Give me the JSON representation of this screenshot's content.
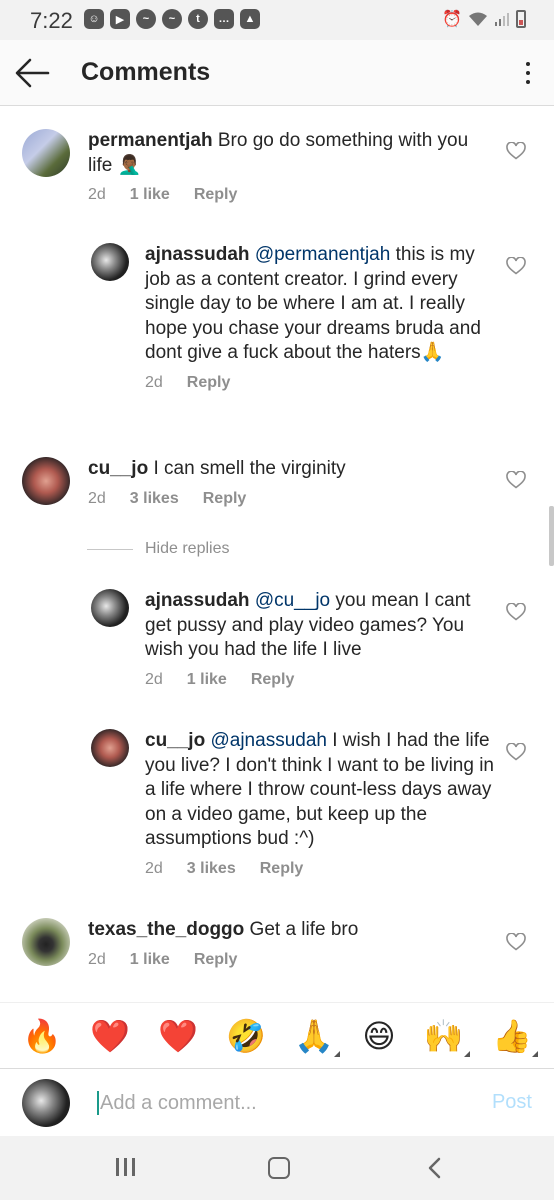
{
  "status_bar": {
    "time": "7:22",
    "left_icons": [
      "discord-icon",
      "youtube-icon",
      "messenger-icon",
      "messenger-icon",
      "tumblr-icon",
      "chat-icon",
      "gallery-icon"
    ],
    "right_icons": [
      "alarm-icon",
      "wifi-icon",
      "signal-icon",
      "battery-low-icon"
    ]
  },
  "header": {
    "title": "Comments",
    "back_icon": "arrow-left-icon",
    "menu_icon": "more-vertical-icon"
  },
  "comments": [
    {
      "username": "permanentjah",
      "text": "Bro go do something with you life 🤦🏾‍♂️",
      "time": "2d",
      "likes": "1 like",
      "reply": "Reply"
    },
    {
      "username": "ajnassudah",
      "mention": "@permanentjah",
      "text": "this is my job as a content creator. I grind every single day to be where I am at. I really hope you chase your dreams bruda and dont give a fuck about the haters🙏",
      "time": "2d",
      "reply": "Reply"
    },
    {
      "username": "cu__jo",
      "text": "I can smell the virginity",
      "time": "2d",
      "likes": "3 likes",
      "reply": "Reply"
    },
    {
      "username": "ajnassudah",
      "mention": "@cu__jo",
      "text": "you mean I cant get pussy and play video games? You wish you had the life I live",
      "time": "2d",
      "likes": "1 like",
      "reply": "Reply"
    },
    {
      "username": "cu__jo",
      "mention": "@ajnassudah",
      "text": "I wish I had the life you live? I don't think I want to be living in a life where I throw count-less days away on a video game, but keep up the assumptions bud :^)",
      "time": "2d",
      "likes": "3 likes",
      "reply": "Reply"
    },
    {
      "username": "texas_the_doggo",
      "text": "Get a life bro",
      "time": "2d",
      "likes": "1 like",
      "reply": "Reply"
    }
  ],
  "hide_replies": "Hide replies",
  "emoji_bar": [
    "🔥",
    "❤️",
    "❤️",
    "🤣",
    "🙏",
    "😄",
    "🙌",
    "👍"
  ],
  "add_comment": {
    "placeholder": "Add a comment...",
    "post_label": "Post"
  },
  "colors": {
    "mention": "#003569",
    "secondary_text": "#8e8e8e",
    "post_disabled": "#b2dffc"
  }
}
